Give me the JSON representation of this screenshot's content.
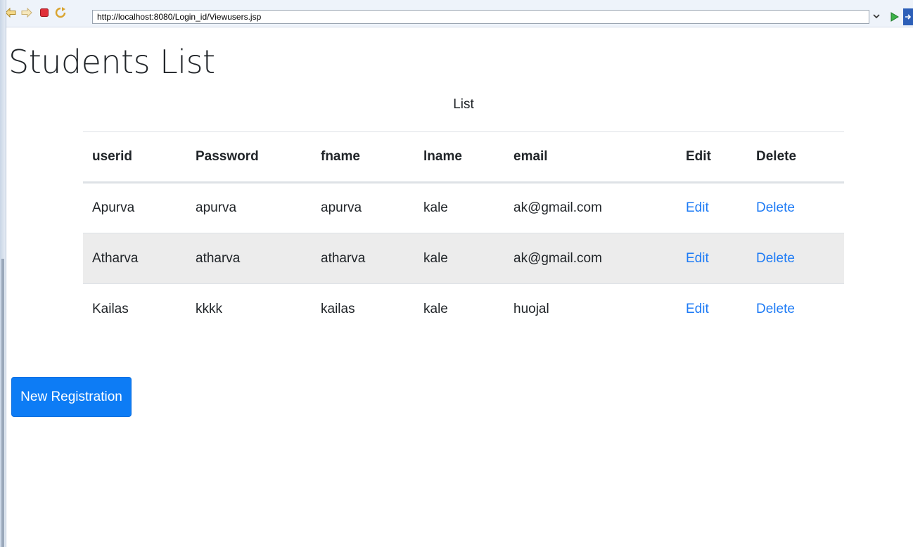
{
  "browser": {
    "url": "http://localhost:8080/Login_id/Viewusers.jsp"
  },
  "page": {
    "title": "Students List",
    "caption": "List"
  },
  "table": {
    "headers": [
      "userid",
      "Password",
      "fname",
      "lname",
      "email",
      "Edit",
      "Delete"
    ],
    "rows": [
      {
        "userid": "Apurva",
        "password": "apurva",
        "fname": "apurva",
        "lname": "kale",
        "email": "ak@gmail.com",
        "edit": "Edit",
        "delete": "Delete"
      },
      {
        "userid": "Atharva",
        "password": "atharva",
        "fname": "atharva",
        "lname": "kale",
        "email": "ak@gmail.com",
        "edit": "Edit",
        "delete": "Delete"
      },
      {
        "userid": "Kailas",
        "password": "kkkk",
        "fname": "kailas",
        "lname": "kale",
        "email": "huojal",
        "edit": "Edit",
        "delete": "Delete"
      }
    ]
  },
  "actions": {
    "new_registration_label": "New Registration"
  },
  "colors": {
    "link": "#1e7bf5",
    "primary_button": "#0d7cf5",
    "striped_row": "#ececec",
    "toolbar_bg": "#eef3fa"
  },
  "icons": {
    "back": "back-arrow-icon",
    "forward": "forward-arrow-icon",
    "stop": "stop-icon",
    "refresh": "refresh-icon",
    "dropdown": "chevron-down-icon",
    "go": "go-play-icon",
    "extension": "extension-icon"
  }
}
